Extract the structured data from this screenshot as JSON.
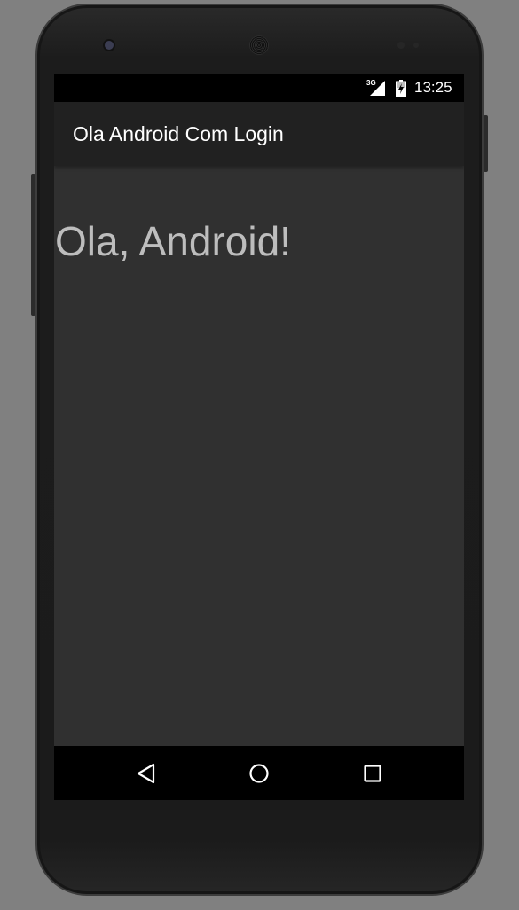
{
  "device": {
    "icons": [
      "camera-icon",
      "speaker-grille-icon",
      "sensor-icon"
    ]
  },
  "status_bar": {
    "network": "3G",
    "time": "13:25",
    "icons": [
      "signal-icon",
      "battery-charging-icon"
    ]
  },
  "app_bar": {
    "title": "Ola Android Com Login"
  },
  "content": {
    "greeting": "Ola, Android!"
  },
  "nav_bar": {
    "buttons": [
      "back-icon",
      "home-icon",
      "recents-icon"
    ]
  },
  "colors": {
    "background": "#808080",
    "status_bar": "#000000",
    "app_bar": "#212121",
    "content": "#303030",
    "greeting_text": "#bdbdbd"
  }
}
